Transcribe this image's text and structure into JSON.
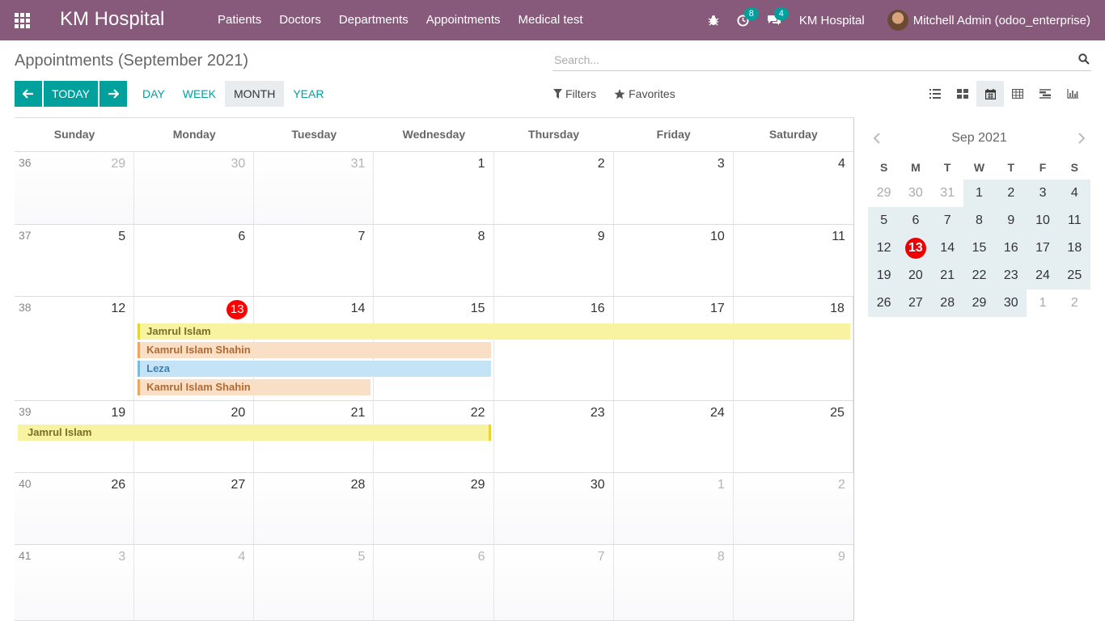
{
  "navbar": {
    "brand": "KM Hospital",
    "menu": [
      "Patients",
      "Doctors",
      "Departments",
      "Appointments",
      "Medical test"
    ],
    "activity_count": "8",
    "message_count": "4",
    "company": "KM Hospital",
    "user": "Mitchell Admin (odoo_enterprise)"
  },
  "control": {
    "title": "Appointments (September 2021)",
    "search_placeholder": "Search...",
    "today_label": "TODAY",
    "scales": [
      "DAY",
      "WEEK",
      "MONTH",
      "YEAR"
    ],
    "active_scale": "MONTH",
    "filters_label": "Filters",
    "favorites_label": "Favorites"
  },
  "calendar": {
    "weekdays": [
      "Sunday",
      "Monday",
      "Tuesday",
      "Wednesday",
      "Thursday",
      "Friday",
      "Saturday"
    ],
    "weeks": [
      {
        "num": "36",
        "days": [
          "29",
          "30",
          "31",
          "1",
          "2",
          "3",
          "4"
        ],
        "other": [
          true,
          true,
          true,
          false,
          false,
          false,
          false
        ]
      },
      {
        "num": "37",
        "days": [
          "5",
          "6",
          "7",
          "8",
          "9",
          "10",
          "11"
        ],
        "other": [
          false,
          false,
          false,
          false,
          false,
          false,
          false
        ]
      },
      {
        "num": "38",
        "days": [
          "12",
          "13",
          "14",
          "15",
          "16",
          "17",
          "18"
        ],
        "other": [
          false,
          false,
          false,
          false,
          false,
          false,
          false
        ]
      },
      {
        "num": "39",
        "days": [
          "19",
          "20",
          "21",
          "22",
          "23",
          "24",
          "25"
        ],
        "other": [
          false,
          false,
          false,
          false,
          false,
          false,
          false
        ]
      },
      {
        "num": "40",
        "days": [
          "26",
          "27",
          "28",
          "29",
          "30",
          "1",
          "2"
        ],
        "other": [
          false,
          false,
          false,
          false,
          false,
          true,
          true
        ]
      },
      {
        "num": "41",
        "days": [
          "3",
          "4",
          "5",
          "6",
          "7",
          "8",
          "9"
        ],
        "other": [
          true,
          true,
          true,
          true,
          true,
          true,
          true
        ]
      }
    ],
    "today": "13",
    "events": [
      {
        "label": "Jamrul Islam",
        "week": 2,
        "start": 1,
        "end": 6,
        "row": 0,
        "color": "yellow"
      },
      {
        "label": "Kamrul Islam Shahin",
        "week": 2,
        "start": 1,
        "end": 3,
        "row": 1,
        "color": "orange"
      },
      {
        "label": "Leza",
        "week": 2,
        "start": 1,
        "end": 3,
        "row": 2,
        "color": "blue"
      },
      {
        "label": "Kamrul Islam Shahin",
        "week": 2,
        "start": 1,
        "end": 2,
        "row": 3,
        "color": "orange"
      },
      {
        "label": "Jamrul Islam",
        "week": 3,
        "start": 0,
        "end": 3,
        "row": 0,
        "color": "yellow-r"
      }
    ]
  },
  "mini": {
    "title": "Sep 2021",
    "dow": [
      "S",
      "M",
      "T",
      "W",
      "T",
      "F",
      "S"
    ],
    "rows": [
      [
        "29",
        "30",
        "31",
        "1",
        "2",
        "3",
        "4"
      ],
      [
        "5",
        "6",
        "7",
        "8",
        "9",
        "10",
        "11"
      ],
      [
        "12",
        "13",
        "14",
        "15",
        "16",
        "17",
        "18"
      ],
      [
        "19",
        "20",
        "21",
        "22",
        "23",
        "24",
        "25"
      ],
      [
        "26",
        "27",
        "28",
        "29",
        "30",
        "1",
        "2"
      ]
    ]
  },
  "colors": {
    "navbar": "#875a7b",
    "accent": "#00a09d",
    "today": "#ff0000"
  }
}
